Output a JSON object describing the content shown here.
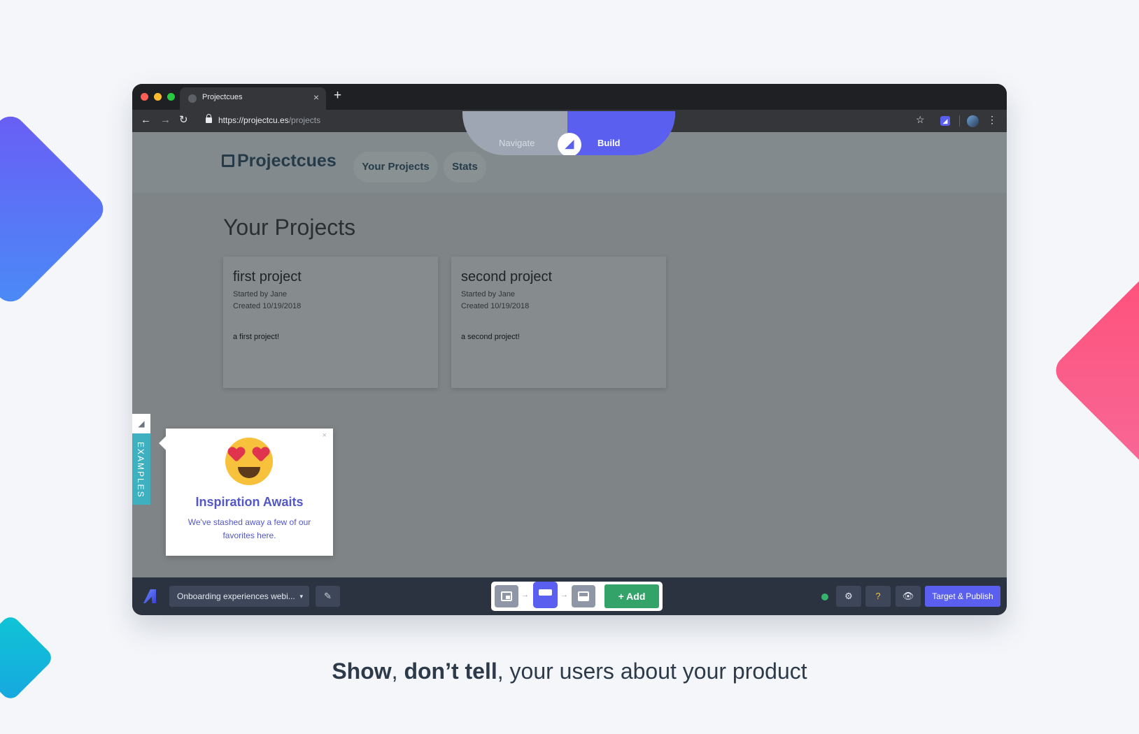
{
  "browser": {
    "tab_title": "Projectcues",
    "tab_close": "×",
    "new_tab": "+",
    "url_host": "https://projectcu.es",
    "url_path": "/projects",
    "icons": {
      "back": "←",
      "forward": "→",
      "reload": "↻",
      "star": "☆",
      "menu": "⋮"
    }
  },
  "mode_toggle": {
    "navigate_label": "Navigate",
    "build_label": "Build"
  },
  "app": {
    "logo": "Projectcues",
    "nav": {
      "projects": "Your Projects",
      "stats": "Stats"
    },
    "page_title": "Your Projects",
    "projects": [
      {
        "title": "first project",
        "started": "Started by Jane",
        "created": "Created 10/19/2018",
        "description": "a first project!"
      },
      {
        "title": "second project",
        "started": "Started by Jane",
        "created": "Created 10/19/2018",
        "description": "a second project!"
      }
    ]
  },
  "examples_tab": {
    "label": "EXAMPLES"
  },
  "tooltip": {
    "close": "×",
    "title": "Inspiration Awaits",
    "body": "We've stashed away a few of our favorites here."
  },
  "builder": {
    "flow_select": "Onboarding experiences webi...",
    "flow_caret": "▾",
    "edit_icon": "✎",
    "step_arrow": "→",
    "add_label": "+ Add",
    "settings_icon": "⚙",
    "help_icon": "?",
    "preview_icon": "👁",
    "publish_label": "Target & Publish",
    "colors": {
      "accent": "#5a5ff0",
      "add": "#34a36a",
      "status": "#35b36d"
    }
  },
  "tagline": {
    "strong1": "Show",
    "sep": ", ",
    "strong2": "don’t tell",
    "rest": ", your users about your product"
  }
}
